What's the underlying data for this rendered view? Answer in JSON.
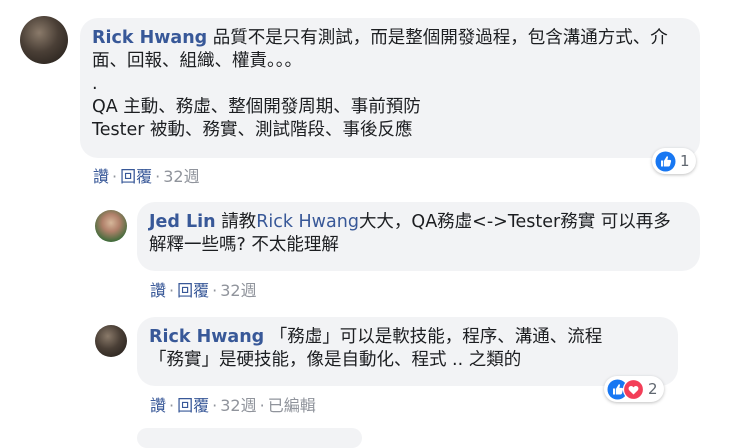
{
  "comments": [
    {
      "author": "Rick Hwang",
      "text": "品質不是只有測試，而是整個開發過程，包含溝通方式、介面、回報、組織、權責。。。\n.\nQA 主動、務虛、整個開發周期、事前預防\nTester 被動、務實、測試階段、事後反應",
      "actions": {
        "like": "讚",
        "reply": "回覆",
        "time": "32週"
      },
      "reactions": {
        "count": "1",
        "types": [
          "like-icon"
        ]
      }
    },
    {
      "author": "Jed Lin",
      "text_before": "請教",
      "mention": "Rick Hwang",
      "text_after": "大大，QA務虛<->Tester務實 可以再多解釋一些嗎? 不太能理解",
      "actions": {
        "like": "讚",
        "reply": "回覆",
        "time": "32週"
      }
    },
    {
      "author": "Rick Hwang",
      "text": "「務虛」可以是軟技能，程序、溝通、流程\n「務實」是硬技能，像是自動化、程式 .. 之類的",
      "actions": {
        "like": "讚",
        "reply": "回覆",
        "time": "32週",
        "edited": "已編輯"
      },
      "reactions": {
        "count": "2",
        "types": [
          "like-icon",
          "love-icon"
        ]
      }
    }
  ],
  "colors": {
    "link": "#385898",
    "bubble": "#f2f3f5",
    "meta": "#90949c",
    "like": "#1877f2",
    "love": "#f33e58"
  }
}
